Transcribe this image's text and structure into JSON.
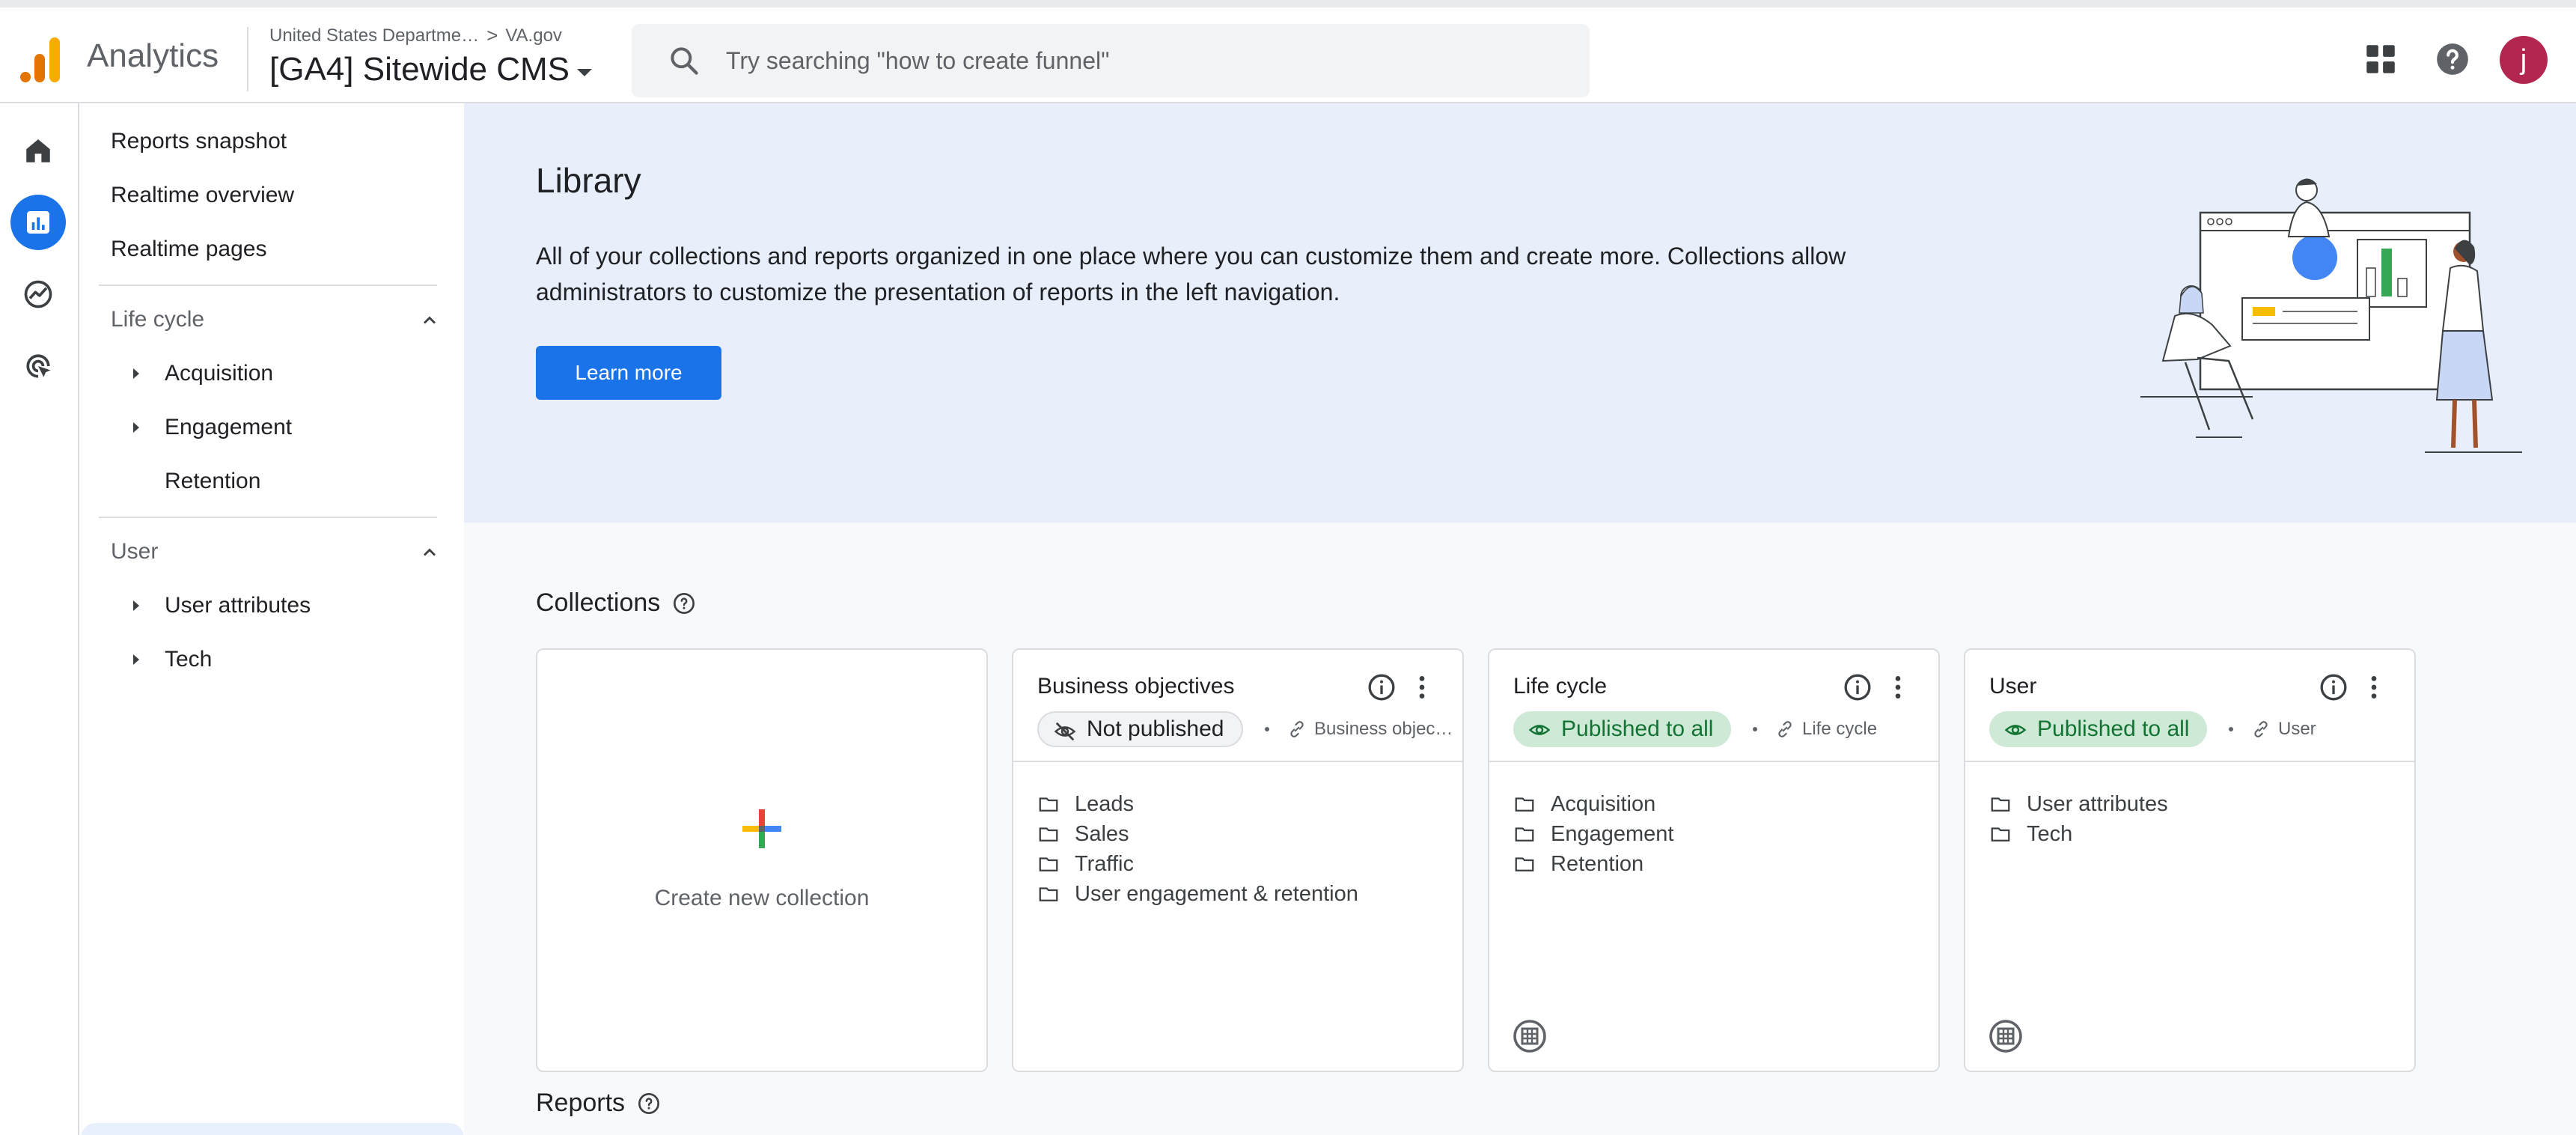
{
  "header": {
    "app_name": "Analytics",
    "breadcrumb_account": "United States Departme…",
    "breadcrumb_sep": ">",
    "breadcrumb_property": "VA.gov",
    "property_name": "[GA4] Sitewide CMS",
    "search_placeholder": "Try searching \"how to create funnel\"",
    "avatar_letter": "j"
  },
  "sidebar": {
    "top_links": [
      "Reports snapshot",
      "Realtime overview",
      "Realtime pages"
    ],
    "sections": [
      {
        "title": "Life cycle",
        "items": [
          "Acquisition",
          "Engagement",
          "Retention"
        ]
      },
      {
        "title": "User",
        "items": [
          "User attributes",
          "Tech"
        ]
      }
    ]
  },
  "library": {
    "title": "Library",
    "description": "All of your collections and reports organized in one place where you can customize them and create more. Collections allow administrators to customize the presentation of reports in the left navigation.",
    "learn_more": "Learn more"
  },
  "collections": {
    "title": "Collections",
    "create_label": "Create new collection",
    "cards": [
      {
        "title": "Business objectives",
        "status": "Not published",
        "template": "Business objec…",
        "folders": [
          "Leads",
          "Sales",
          "Traffic",
          "User engagement & retention"
        ]
      },
      {
        "title": "Life cycle",
        "status": "Published to all",
        "template": "Life cycle",
        "folders": [
          "Acquisition",
          "Engagement",
          "Retention"
        ]
      },
      {
        "title": "User",
        "status": "Published to all",
        "template": "User",
        "folders": [
          "User attributes",
          "Tech"
        ]
      }
    ]
  },
  "reports": {
    "title": "Reports"
  },
  "colors": {
    "accent": "#1a73e8",
    "published_bg": "#ceead6",
    "published_text": "#137333",
    "avatar": "#b3264f",
    "hero_bg": "#e8effb"
  }
}
